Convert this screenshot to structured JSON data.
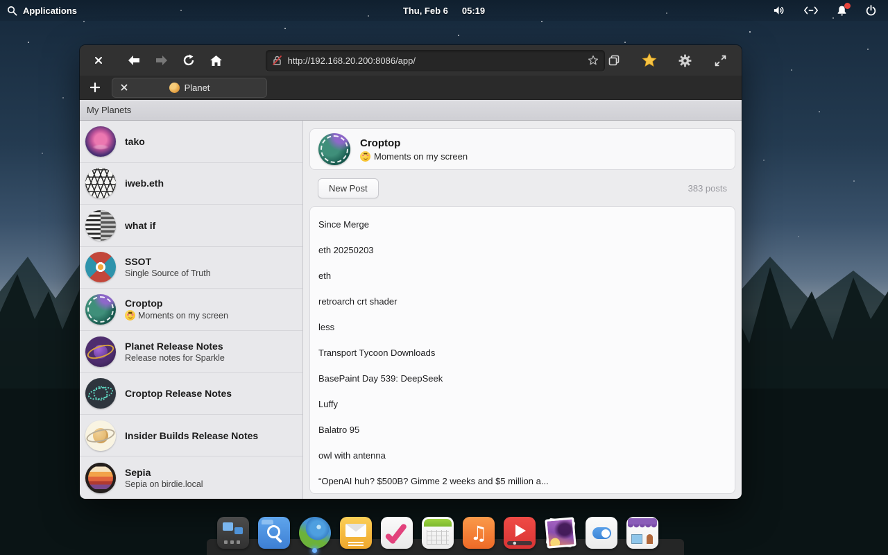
{
  "top_bar": {
    "applications_label": "Applications",
    "date": "Thu, Feb 6",
    "time": "05:19"
  },
  "browser": {
    "url": "http://192.168.20.200:8086/app/",
    "tab_title": "Planet"
  },
  "app": {
    "header_title": "My Planets",
    "sidebar": {
      "items": [
        {
          "name": "tako",
          "subtitle": "",
          "avatar": "av-tako"
        },
        {
          "name": "iweb.eth",
          "subtitle": "",
          "avatar": "av-iweb"
        },
        {
          "name": "what if",
          "subtitle": "",
          "avatar": "av-whatif"
        },
        {
          "name": "SSOT",
          "subtitle": "Single Source of Truth",
          "avatar": "av-ssot"
        },
        {
          "name": "Croptop",
          "subtitle": "Moments on my screen",
          "emoji": "smiling-face-with-hearts",
          "avatar": "av-croptop"
        },
        {
          "name": "Planet Release Notes",
          "subtitle": "Release notes for Sparkle",
          "avatar": "av-planetrn"
        },
        {
          "name": "Croptop Release Notes",
          "subtitle": "",
          "avatar": "av-croptoprn"
        },
        {
          "name": "Insider Builds Release Notes",
          "subtitle": "",
          "avatar": "av-insider"
        },
        {
          "name": "Sepia",
          "subtitle": "Sepia on birdie.local",
          "avatar": "av-sepia"
        }
      ]
    },
    "main": {
      "title": "Croptop",
      "subtitle": "Moments on my screen",
      "subtitle_emoji": "smiling-face-with-hearts",
      "new_post_label": "New Post",
      "posts_count": "383 posts",
      "posts": [
        "Since Merge",
        "eth 20250203",
        "eth",
        "retroarch crt shader",
        "less",
        "Transport Tycoon Downloads",
        "BasePaint Day 539: DeepSeek",
        "Luffy",
        "Balatro 95",
        "owl with antenna",
        "“OpenAI huh? $500B? Gimme 2 weeks and $5 million a..."
      ]
    }
  },
  "dock": {
    "items": [
      "multitasking-view",
      "file-search",
      "web-browser",
      "mail",
      "tasks",
      "calendar",
      "music",
      "videos",
      "photos",
      "system-settings",
      "appcenter"
    ]
  }
}
